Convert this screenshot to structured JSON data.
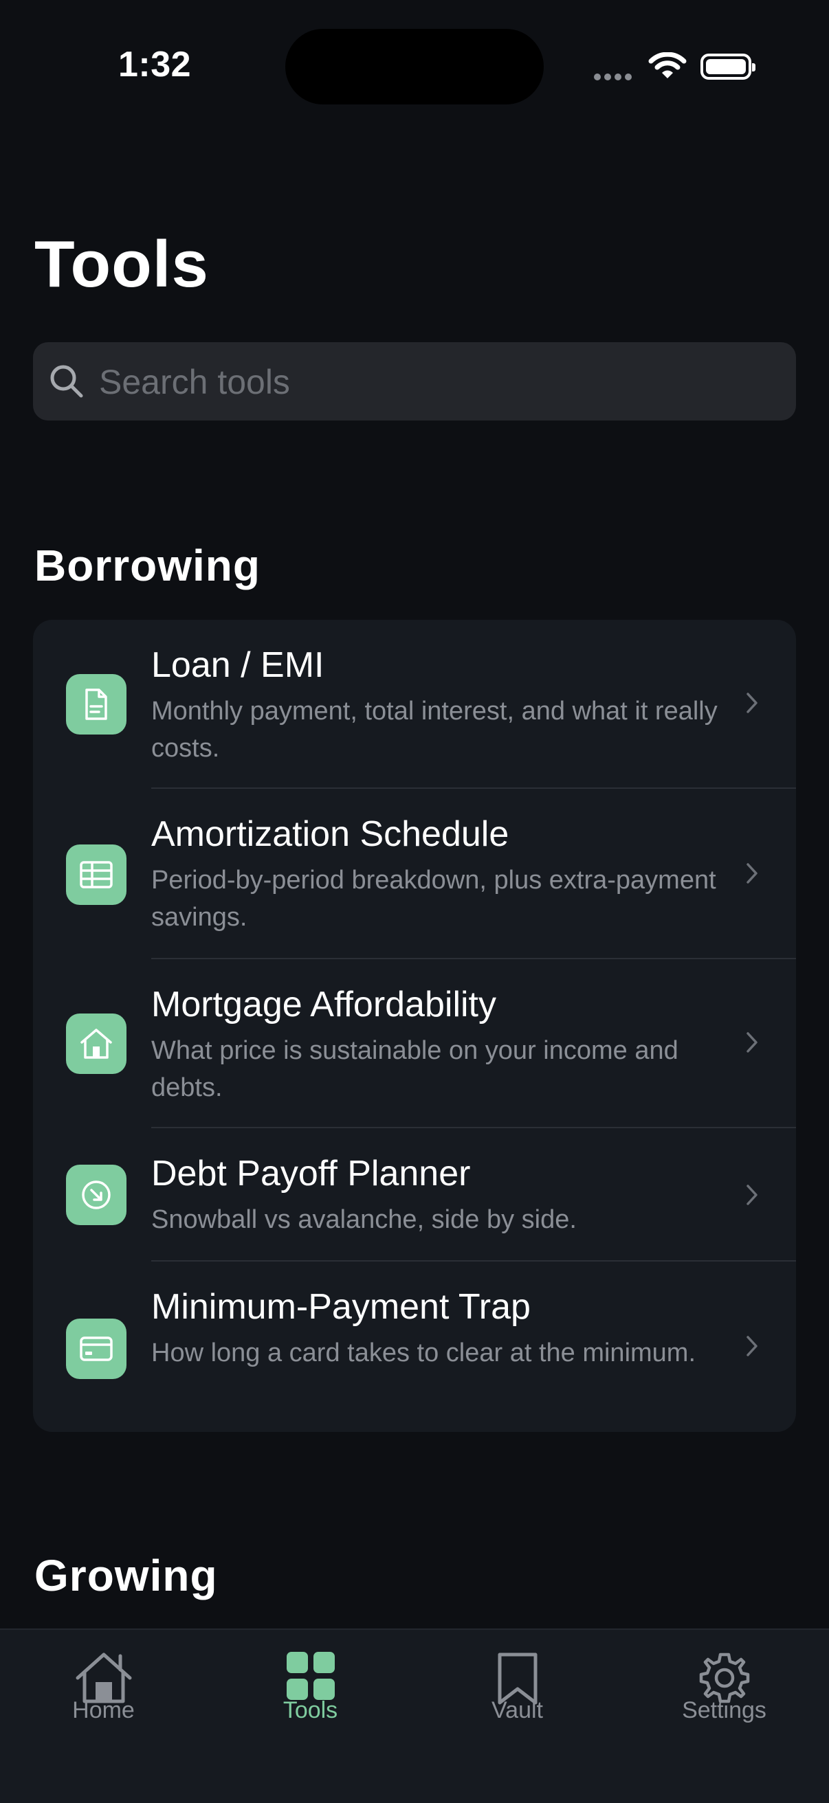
{
  "status": {
    "time": "1:32"
  },
  "page": {
    "title": "Tools"
  },
  "search": {
    "placeholder": "Search tools",
    "value": ""
  },
  "sections": [
    {
      "title": "Borrowing",
      "items": [
        {
          "title": "Loan / EMI",
          "description": "Monthly payment, total interest, and what it really costs.",
          "icon": "document-icon"
        },
        {
          "title": "Amortization Schedule",
          "description": "Period-by-period breakdown, plus extra-payment savings.",
          "icon": "table-icon"
        },
        {
          "title": "Mortgage Affordability",
          "description": "What price is sustainable on your income and debts.",
          "icon": "house-icon"
        },
        {
          "title": "Debt Payoff Planner",
          "description": "Snowball vs avalanche, side by side.",
          "icon": "arrow-down-right-circle-icon"
        },
        {
          "title": "Minimum-Payment Trap",
          "description": "How long a card takes to clear at the minimum.",
          "icon": "credit-card-icon"
        }
      ]
    },
    {
      "title": "Growing"
    }
  ],
  "tabbar": [
    {
      "label": "Home",
      "icon": "home-icon",
      "active": false
    },
    {
      "label": "Tools",
      "icon": "grid-icon",
      "active": true
    },
    {
      "label": "Vault",
      "icon": "bookmark-icon",
      "active": false
    },
    {
      "label": "Settings",
      "icon": "gear-icon",
      "active": false
    }
  ],
  "colors": {
    "background": "#0d0f13",
    "card": "#161a20",
    "accent": "#7fcc9f",
    "secondary_text": "#8b8f96"
  }
}
